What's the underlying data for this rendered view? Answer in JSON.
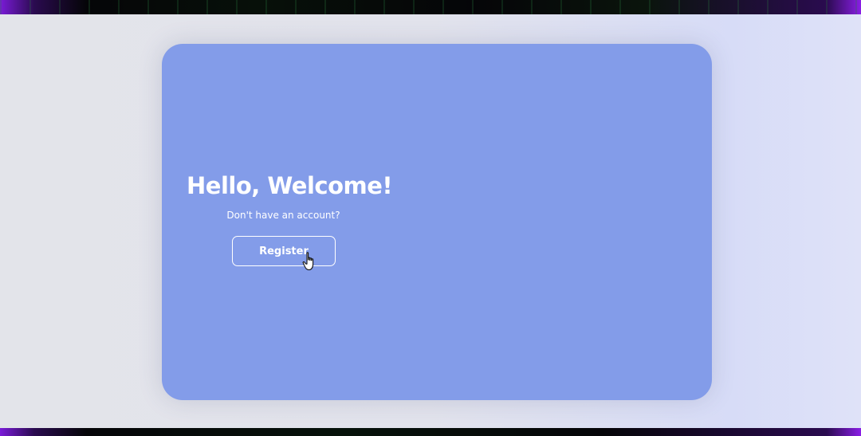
{
  "welcome": {
    "title": "Hello, Welcome!",
    "subtitle": "Don't have an account?",
    "register_label": "Register"
  },
  "colors": {
    "card_background": "#839ce9",
    "page_background": "#e3e4ea",
    "text": "#ffffff",
    "frame_accent": "#8a1ee6"
  },
  "icons": {
    "cursor": "hand-pointer-icon"
  }
}
